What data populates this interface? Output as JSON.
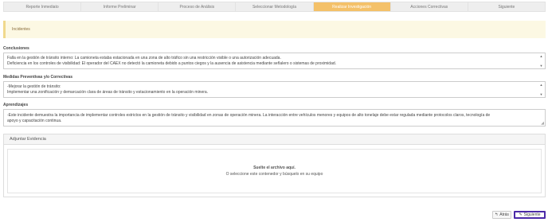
{
  "tabs": [
    {
      "label": "Reporte Inmediato",
      "active": false
    },
    {
      "label": "Informe Preliminar",
      "active": false
    },
    {
      "label": "Proceso de Análisis",
      "active": false
    },
    {
      "label": "Seleccionar Metodología",
      "active": false
    },
    {
      "label": "Realizar Investigación",
      "active": true
    },
    {
      "label": "Acciones Correctivas",
      "active": false
    },
    {
      "label": "Siguiente",
      "active": false
    }
  ],
  "banner": {
    "text": "Incidentes"
  },
  "conclusiones": {
    "label": "Conclusiones",
    "lines": [
      "Falla en la gestión de tránsito interno: La camioneta estaba estacionada en una zona de alto tráfico sin una restricción visible o una autorización adecuada.",
      "Deficiencia en los controles de visibilidad: El operador del CAEX no detectó la camioneta debido a puntos ciegos y la ausencia de asistencia mediante señalero o sistemas de proximidad."
    ]
  },
  "medidas": {
    "label": "Medidas Preventivas y/o Correctivas",
    "lines": [
      "-Mejorar la gestión de tránsito:",
      "Implementar una zonificación y demarcación clara de áreas de tránsito y estacionamiento en la operación minera."
    ]
  },
  "aprendizajes": {
    "label": "Aprendizajes",
    "lines": [
      "-Este incidente demuestra la importancia de implementar controles estrictos en la gestión de tránsito y visibilidad en zonas de operación minera. La interacción entre vehículos menores y equipos de alto tonelaje debe estar regulada mediante protocolos claros, tecnología de",
      "apoyo y capacitación continua."
    ]
  },
  "evidencia": {
    "title": "Adjuntar Evidencia",
    "drop_title": "Suelte el archivo aquí.",
    "drop_sub": "O seleccione este contenedor y búsquelo en su equipo"
  },
  "buttons": {
    "back": "Atrás",
    "next": "Siguiente"
  },
  "icons": {
    "back": "reply-arrow-icon",
    "next": "edit-icon"
  },
  "colors": {
    "active_tab": "#f4c169",
    "banner_bg": "#fcf8e3",
    "next_border": "#4b2aa8"
  }
}
